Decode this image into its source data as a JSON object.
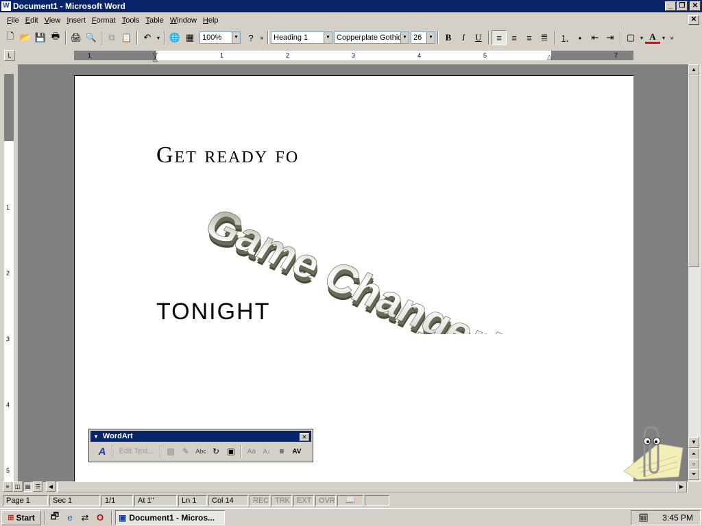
{
  "window": {
    "title": "Document1 - Microsoft Word",
    "app_icon": "W"
  },
  "menu": [
    "File",
    "Edit",
    "View",
    "Insert",
    "Format",
    "Tools",
    "Table",
    "Window",
    "Help"
  ],
  "toolbar": {
    "zoom": "100%",
    "style": "Heading 1",
    "font": "Copperplate Gothic",
    "size": "26",
    "bold": "B",
    "italic": "I",
    "underline": "U",
    "font_color_letter": "A",
    "font_color_accent": "#ff0000"
  },
  "ruler": {
    "numbers": [
      "1",
      "1",
      "2",
      "3",
      "4",
      "5",
      "7"
    ]
  },
  "vruler": {
    "numbers": [
      "1",
      "2",
      "3",
      "4",
      "5"
    ]
  },
  "document": {
    "line1": "Get ready fo",
    "wordart": "Game Changer!",
    "line2": "TONIGHT"
  },
  "wordart_toolbar": {
    "title": "WordArt",
    "edit_text": "Edit Text..."
  },
  "status": {
    "page": "Page 1",
    "sec": "Sec 1",
    "pages": "1/1",
    "at": "At 1\"",
    "ln": "Ln 1",
    "col": "Col 14",
    "rec": "REC",
    "trk": "TRK",
    "ext": "EXT",
    "ovr": "OVR"
  },
  "taskbar": {
    "start": "Start",
    "task": "Document1 - Micros...",
    "clock": "3:45 PM"
  }
}
